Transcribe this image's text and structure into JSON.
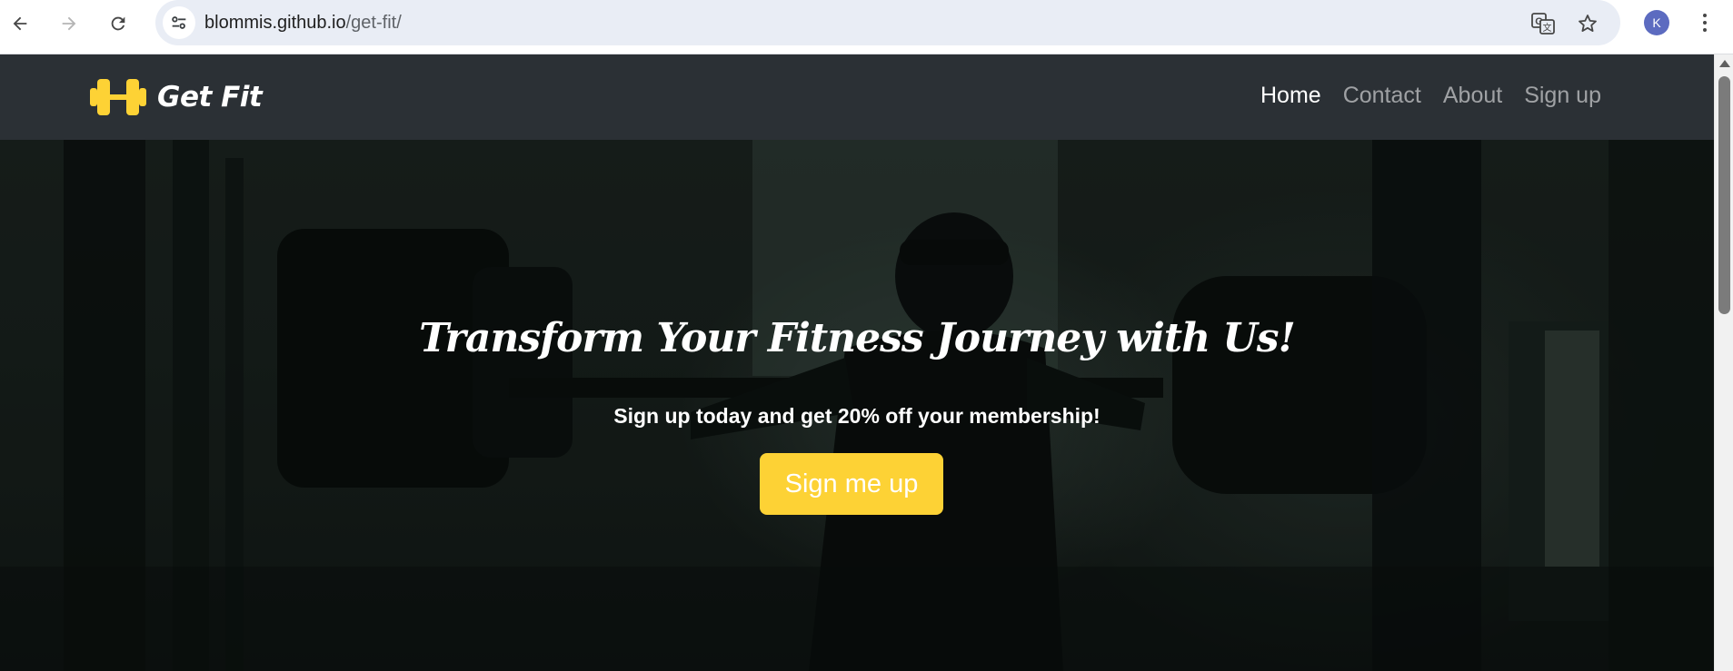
{
  "browser": {
    "url_domain": "blommis.github.io",
    "url_path": "/get-fit/",
    "profile_initial": "K",
    "icons": {
      "back": "arrow-left-icon",
      "forward": "arrow-right-icon",
      "reload": "reload-icon",
      "site_info": "tune-icon",
      "translate": "translate-icon",
      "bookmark": "star-icon",
      "menu": "more-vert-icon"
    }
  },
  "header": {
    "brand": "Get Fit",
    "brand_icon": "dumbbell-icon",
    "nav": [
      {
        "label": "Home",
        "active": true
      },
      {
        "label": "Contact",
        "active": false
      },
      {
        "label": "About",
        "active": false
      },
      {
        "label": "Sign up",
        "active": false
      }
    ]
  },
  "hero": {
    "title": "Transform Your Fitness Journey with Us!",
    "subtitle": "Sign up today and get 20% off your membership!",
    "cta_label": "Sign me up"
  },
  "colors": {
    "header_bg": "#2b3035",
    "accent": "#fdd235",
    "nav_active": "#ffffff",
    "nav_inactive": "rgba(255,255,255,0.55)"
  }
}
